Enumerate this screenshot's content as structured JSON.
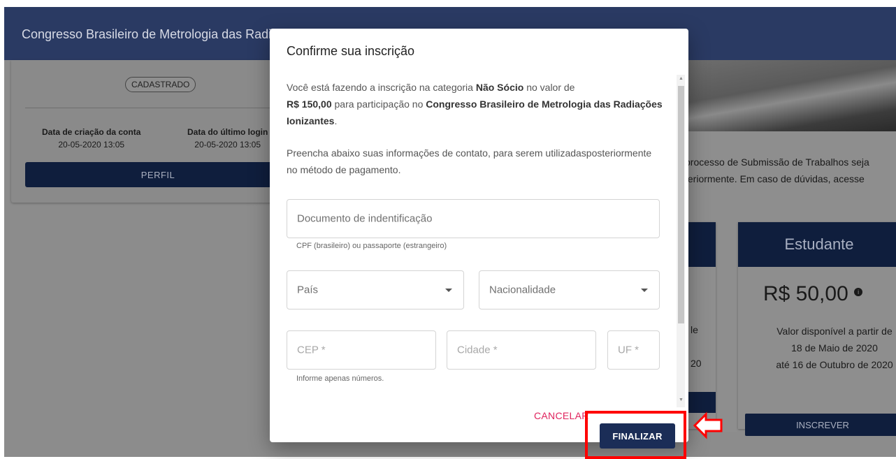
{
  "header": {
    "title": "Congresso Brasileiro de Metrologia das Radiações Ionizantes"
  },
  "profile": {
    "status_badge": "CADASTRADO",
    "created_label": "Data de criação da conta",
    "created_value": "20-05-2020 13:05",
    "last_login_label": "Data do último login",
    "last_login_value": "20-05-2020 13:05",
    "perfil_button": "PERFIL"
  },
  "main": {
    "info_line1": "processo de Submissão de Trabalhos seja",
    "info_line2": "teriormente. Em caso de dúvidas, acesse",
    "left_card_frag1": "le",
    "left_card_frag2": "20",
    "category": {
      "name": "Estudante",
      "price": "R$ 50,00",
      "desc1": "Valor disponível a partir de",
      "desc2": "18 de Maio de 2020",
      "desc3": "até 16 de Outubro de 2020",
      "button": "INSCREVER"
    }
  },
  "dialog": {
    "title": "Confirme sua inscrição",
    "p1_a": "Você está fazendo a inscrição na categoria ",
    "p1_category": "Não Sócio",
    "p1_b": " no valor de",
    "p1_price": "R$ 150,00",
    "p1_c": " para participação no ",
    "p1_event": "Congresso Brasileiro de Metrologia das Radiações Ionizantes",
    "p1_end": ".",
    "p2": "Preencha abaixo suas informações de contato, para serem utilizadasposteriormente no método de pagamento.",
    "doc_placeholder": "Documento de indentificação",
    "doc_hint": "CPF (brasileiro) ou passaporte (estrangeiro)",
    "pais_label": "País",
    "nacionalidade_label": "Nacionalidade",
    "cep_placeholder": "CEP *",
    "cidade_placeholder": "Cidade *",
    "uf_placeholder": "UF *",
    "cep_hint": "Informe apenas números.",
    "cancel_button": "CANCELAR",
    "finalize_button": "FINALIZAR"
  },
  "colors": {
    "header_bg": "#2a3a63",
    "primary_button": "#1b2d57",
    "cancel_text": "#e0245e",
    "highlight": "#ff0000"
  }
}
